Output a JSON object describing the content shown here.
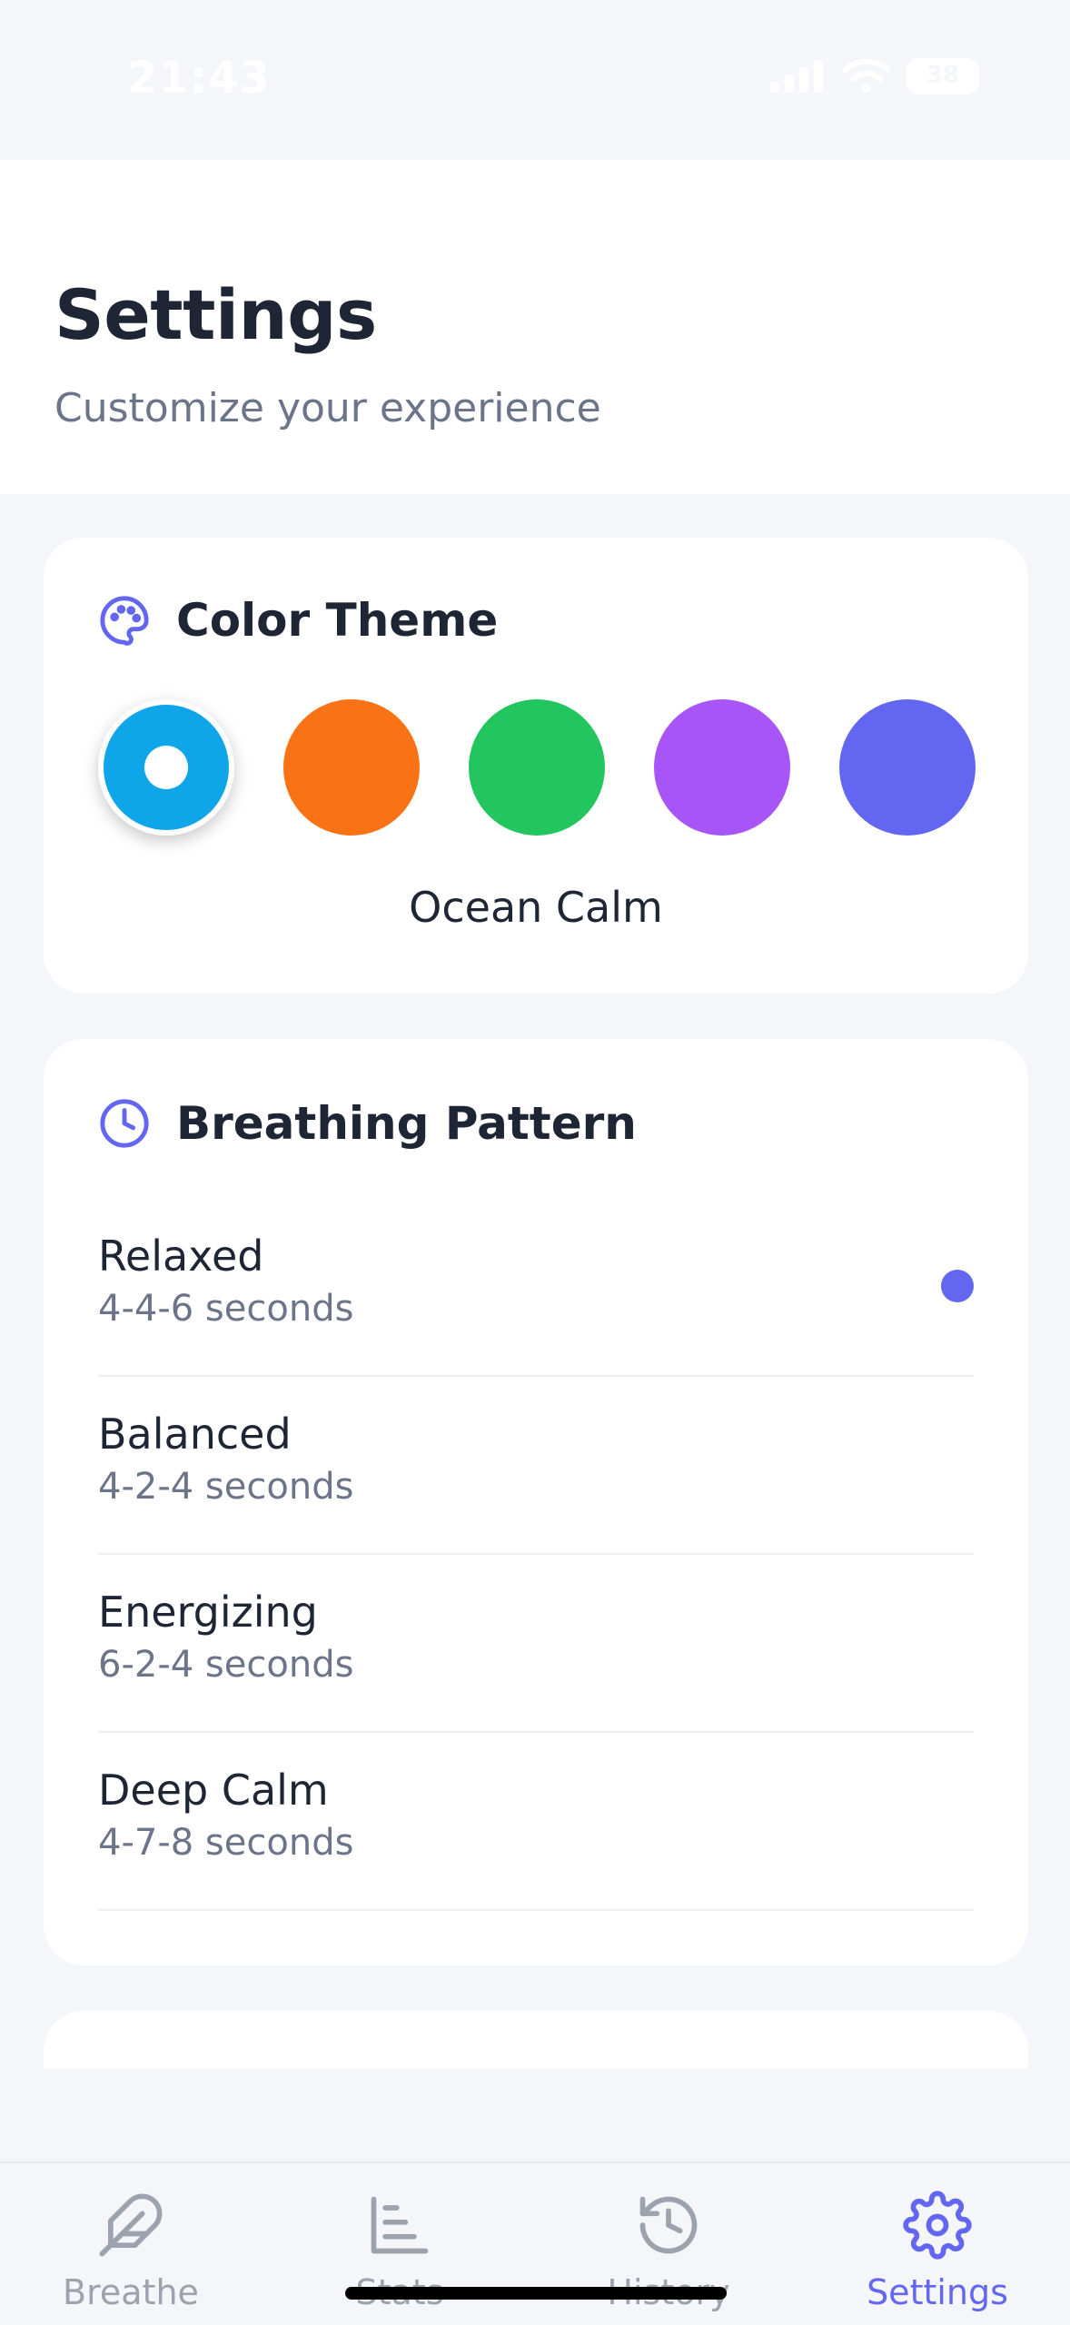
{
  "status_bar": {
    "time": "21:43",
    "battery": "38"
  },
  "header": {
    "title": "Settings",
    "subtitle": "Customize your experience"
  },
  "color_theme": {
    "title": "Color Theme",
    "icon": "palette-icon",
    "swatches": [
      {
        "color": "#0ea5e9",
        "selected": true
      },
      {
        "color": "#f97316",
        "selected": false
      },
      {
        "color": "#22c55e",
        "selected": false
      },
      {
        "color": "#a855f7",
        "selected": false
      },
      {
        "color": "#6366f1",
        "selected": false
      }
    ],
    "selected_name": "Ocean Calm"
  },
  "breathing_pattern": {
    "title": "Breathing Pattern",
    "icon": "clock-icon",
    "items": [
      {
        "name": "Relaxed",
        "description": "4-4-6 seconds",
        "selected": true
      },
      {
        "name": "Balanced",
        "description": "4-2-4 seconds",
        "selected": false
      },
      {
        "name": "Energizing",
        "description": "6-2-4 seconds",
        "selected": false
      },
      {
        "name": "Deep Calm",
        "description": "4-7-8 seconds",
        "selected": false
      }
    ]
  },
  "tab_bar": {
    "tabs": [
      {
        "label": "Breathe",
        "icon": "feather-icon",
        "active": false
      },
      {
        "label": "Stats",
        "icon": "bar-chart-icon",
        "active": false
      },
      {
        "label": "History",
        "icon": "history-icon",
        "active": false
      },
      {
        "label": "Settings",
        "icon": "gear-icon",
        "active": true
      }
    ]
  },
  "colors": {
    "accent": "#6366f1",
    "title_text": "#1e2535",
    "muted_text": "#6b7488",
    "inactive_tab": "#9ca3af"
  }
}
